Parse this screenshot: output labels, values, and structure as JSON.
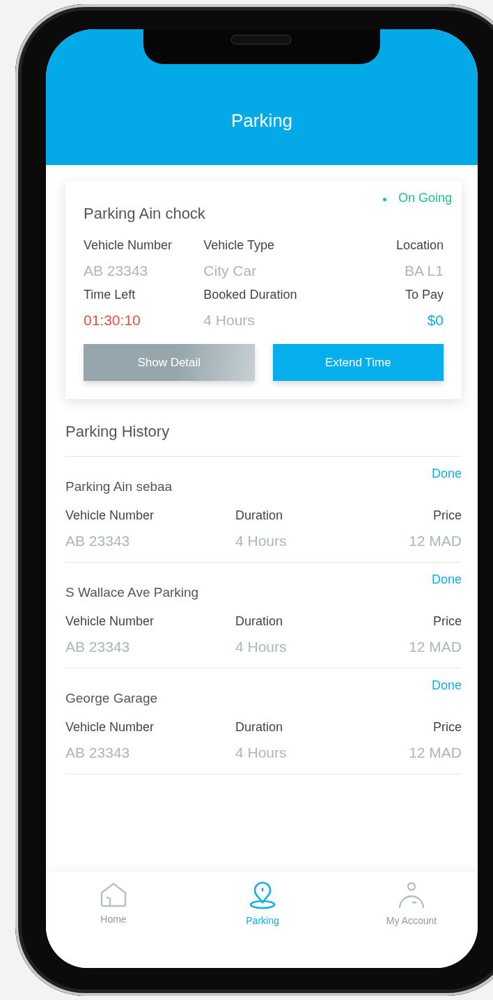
{
  "header": {
    "title": "Parking"
  },
  "current": {
    "name": "Parking Ain chock",
    "status": "On Going",
    "fields": [
      {
        "label": "Vehicle Number",
        "value": "AB 23343",
        "kind": "plain"
      },
      {
        "label": "Vehicle Type",
        "value": "City Car",
        "kind": "plain"
      },
      {
        "label": "Location",
        "value": "BA L1",
        "kind": "plain"
      },
      {
        "label": "Time Left",
        "value": "01:30:10",
        "kind": "countdown"
      },
      {
        "label": "Booked Duration",
        "value": "4 Hours",
        "kind": "plain"
      },
      {
        "label": "To Pay",
        "value": "$0",
        "kind": "amount"
      }
    ],
    "buttons": [
      {
        "label": "Show Detail",
        "kind": "secondary"
      },
      {
        "label": "Extend Time",
        "kind": "primary"
      }
    ]
  },
  "history": {
    "title": "Parking History",
    "items": [
      {
        "name": "Parking Ain sebaa",
        "status": "Done",
        "fields": [
          {
            "label": "Vehicle Number",
            "value": "AB 23343"
          },
          {
            "label": "Duration",
            "value": "4 Hours"
          },
          {
            "label": "Price",
            "value": "12 MAD"
          }
        ]
      },
      {
        "name": "S Wallace Ave Parking",
        "status": "Done",
        "fields": [
          {
            "label": "Vehicle Number",
            "value": "AB 23343"
          },
          {
            "label": "Duration",
            "value": "4 Hours"
          },
          {
            "label": "Price",
            "value": "12 MAD"
          }
        ]
      },
      {
        "name": "George Garage",
        "status": "Done",
        "fields": [
          {
            "label": "Vehicle Number",
            "value": "AB 23343"
          },
          {
            "label": "Duration",
            "value": "4 Hours"
          },
          {
            "label": "Price",
            "value": "12 MAD"
          }
        ]
      }
    ]
  },
  "tabs": [
    {
      "label": "Home",
      "kind": "home",
      "selected": false
    },
    {
      "label": "Parking",
      "kind": "parking",
      "selected": true
    },
    {
      "label": "My Account",
      "kind": "account",
      "selected": false
    }
  ]
}
